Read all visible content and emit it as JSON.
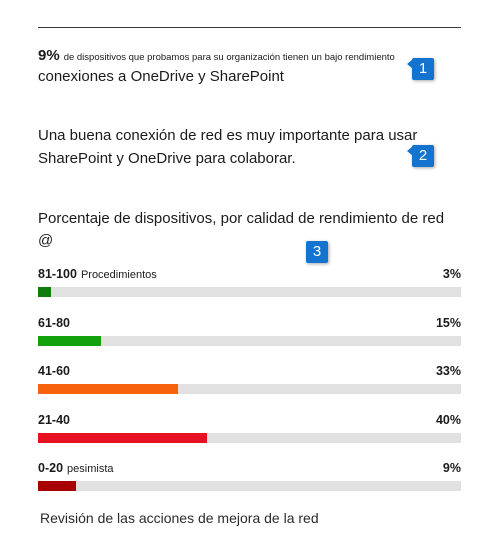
{
  "stat": {
    "percent": "9%",
    "line1_rest": "de dispositivos que probamos para su organización tienen un bajo rendimiento",
    "line2": "conexiones a OneDrive y SharePoint"
  },
  "note": "Una buena conexión de red es muy importante para usar SharePoint y OneDrive para colaborar.",
  "section_heading": "Porcentaje de dispositivos, por calidad de rendimiento de red @",
  "callouts": [
    "1",
    "2",
    "3"
  ],
  "rows": [
    {
      "range": "81-100",
      "desc": "Procedimientos",
      "pct_label": "3%",
      "value": 3,
      "color": "#107c10"
    },
    {
      "range": "61-80",
      "desc": "",
      "pct_label": "15%",
      "value": 15,
      "color": "#13a10e"
    },
    {
      "range": "41-60",
      "desc": "",
      "pct_label": "33%",
      "value": 33,
      "color": "#f7630c"
    },
    {
      "range": "21-40",
      "desc": "",
      "pct_label": "40%",
      "value": 40,
      "color": "#e81123"
    },
    {
      "range": "0-20",
      "desc": "pesimista",
      "pct_label": "9%",
      "value": 9,
      "color": "#a80000"
    }
  ],
  "footer_link": "Revisión de las acciones de mejora de la red"
}
